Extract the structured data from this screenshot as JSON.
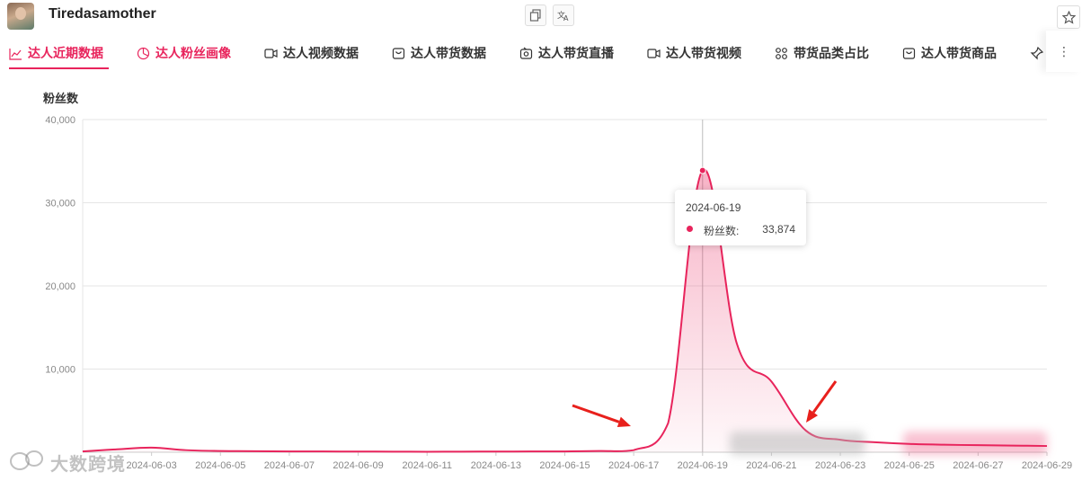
{
  "header": {
    "username": "Tiredasamother",
    "icons": [
      "copy-icon",
      "translate-icon",
      "star-icon"
    ]
  },
  "tabs": [
    {
      "label": "达人近期数据",
      "icon": "line-chart-icon",
      "active": true
    },
    {
      "label": "达人粉丝画像",
      "icon": "pie-chart-icon",
      "active": false
    },
    {
      "label": "达人视频数据",
      "icon": "video-icon",
      "active": false
    },
    {
      "label": "达人带货数据",
      "icon": "bag-icon",
      "active": false
    },
    {
      "label": "达人带货直播",
      "icon": "live-icon",
      "active": false
    },
    {
      "label": "达人带货视频",
      "icon": "video-icon",
      "active": false
    },
    {
      "label": "带货品类占比",
      "icon": "grid-icon",
      "active": false
    },
    {
      "label": "达人带货商品",
      "icon": "bag-icon",
      "active": false
    }
  ],
  "more_label": "⋮",
  "chart_data": {
    "type": "area",
    "title": "粉丝数",
    "ylim": [
      0,
      40000
    ],
    "yticks": [
      "40,000",
      "30,000",
      "20,000",
      "10,000"
    ],
    "xtick_labels": [
      "2024-06-03",
      "2024-06-05",
      "2024-06-07",
      "2024-06-09",
      "2024-06-11",
      "2024-06-13",
      "2024-06-15",
      "2024-06-17",
      "2024-06-19",
      "2024-06-21",
      "2024-06-23",
      "2024-06-25",
      "2024-06-27",
      "2024-06-29"
    ],
    "x": [
      "2024-06-01",
      "2024-06-02",
      "2024-06-03",
      "2024-06-04",
      "2024-06-05",
      "2024-06-06",
      "2024-06-07",
      "2024-06-08",
      "2024-06-09",
      "2024-06-10",
      "2024-06-11",
      "2024-06-12",
      "2024-06-13",
      "2024-06-14",
      "2024-06-15",
      "2024-06-16",
      "2024-06-17",
      "2024-06-18",
      "2024-06-19",
      "2024-06-20",
      "2024-06-21",
      "2024-06-22",
      "2024-06-23",
      "2024-06-24",
      "2024-06-25",
      "2024-06-26",
      "2024-06-27",
      "2024-06-28",
      "2024-06-29"
    ],
    "series": [
      {
        "name": "粉丝数",
        "color": "#e8245c",
        "values": [
          100,
          350,
          550,
          250,
          150,
          120,
          100,
          90,
          80,
          70,
          60,
          70,
          80,
          90,
          100,
          150,
          250,
          3500,
          33874,
          13000,
          8500,
          2600,
          1500,
          1200,
          1000,
          900,
          850,
          800,
          750
        ]
      }
    ],
    "tooltip": {
      "date": "2024-06-19",
      "label": "粉丝数:",
      "value": "33,874"
    },
    "grid": true
  },
  "watermark": "大数跨境"
}
